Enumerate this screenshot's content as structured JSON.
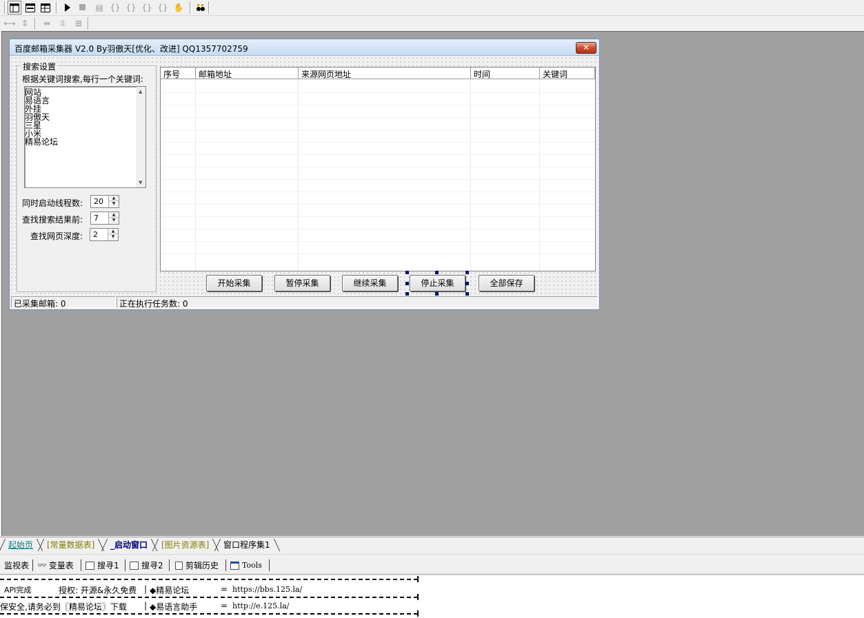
{
  "toolbar1": {
    "buttons": [
      "window-layout-icon",
      "window-list-icon",
      "window-split-icon",
      "run-icon",
      "stop-icon",
      "step-icon",
      "step-into-icon",
      "step-over-icon",
      "step-out-icon",
      "run-to-cursor-icon",
      "hand-icon",
      "find-icon"
    ]
  },
  "form": {
    "title": "百度邮箱采集器 V2.0 By羽傲天[优化、改进]  QQ1357702759",
    "close_symbol": "✕",
    "search_group_title": "搜索设置",
    "keyword_prompt": "根据关键词搜索,每行一个关键词:",
    "keywords": [
      "网站",
      "易语言",
      "外挂",
      "羽傲天",
      "三星",
      "小米",
      "精易论坛"
    ],
    "threads_label": "同时启动线程数:",
    "threads_value": "20",
    "results_label": "查找搜索结果前:",
    "results_value": "7",
    "depth_label": "查找网页深度:",
    "depth_value": "2",
    "columns": [
      "序号",
      "邮箱地址",
      "来源网页地址",
      "时间",
      "关键词"
    ],
    "buttons": {
      "start": "开始采集",
      "pause": "暂停采集",
      "resume": "继续采集",
      "stop": "停止采集",
      "save_all": "全部保存"
    },
    "status_collected": "已采集邮箱: 0",
    "status_tasks": "正在执行任务数: 0"
  },
  "sheet_tabs": [
    "起始页",
    "[常量数据表]",
    "_启动窗口",
    "[图片资源表]",
    "窗口程序集1"
  ],
  "sheet_tab_colors": {
    "start": "#008080",
    "bracket": "#808000",
    "active": "#000080",
    "normal": "#000000"
  },
  "panel_tabs": [
    "监视表",
    "变量表",
    "搜寻1",
    "搜寻2",
    "剪辑历史",
    "Tools"
  ],
  "output": {
    "line1_left": "API完成",
    "line1_mid": "授权: 开源&永久免费",
    "line1_name": "◆精易论坛",
    "line1_eq": "=",
    "line1_url": "https://bbs.125.la/",
    "line2_left": "保安全,请务必到〖精易论坛〗下载",
    "line2_name": "◆易语言助手",
    "line2_eq": "=",
    "line2_url": "http://e.125.la/"
  }
}
